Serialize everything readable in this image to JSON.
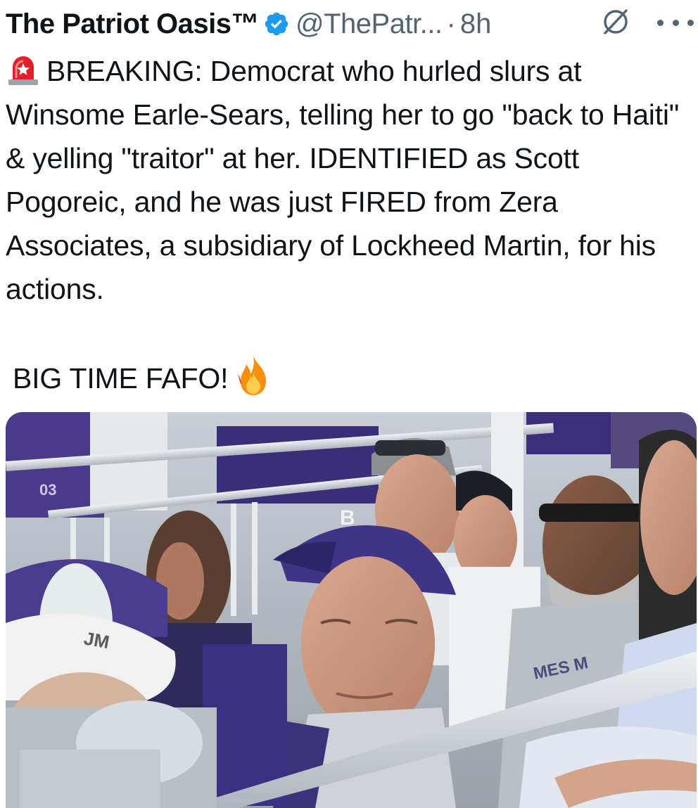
{
  "tweet": {
    "author": {
      "display_name": "The Patriot Oasis™",
      "handle": "@ThePatr...",
      "verified": true
    },
    "separator": "·",
    "time": "8h",
    "header_icons": [
      "grok-icon",
      "more-options-icon"
    ],
    "body": {
      "emoji_start": "siren-emoji",
      "paragraph_1": "BREAKING: Democrat who hurled slurs at Winsome Earle-Sears, telling her to go \"back to Haiti\" & yelling \"traitor\" at her. IDENTIFIED as Scott Pogoreic, and he was just FIRED from Zera Associates, a subsidiary of Lockheed Martin, for his actions.",
      "paragraph_2": "BIG TIME FAFO!",
      "emoji_end": "fire-emoji"
    },
    "media": {
      "type": "photo",
      "visible_text": [
        "03",
        "B",
        "JM",
        "MES M"
      ]
    },
    "colors": {
      "text": "#0f1419",
      "secondary": "#536471",
      "verified": "#1d9bf0"
    }
  }
}
